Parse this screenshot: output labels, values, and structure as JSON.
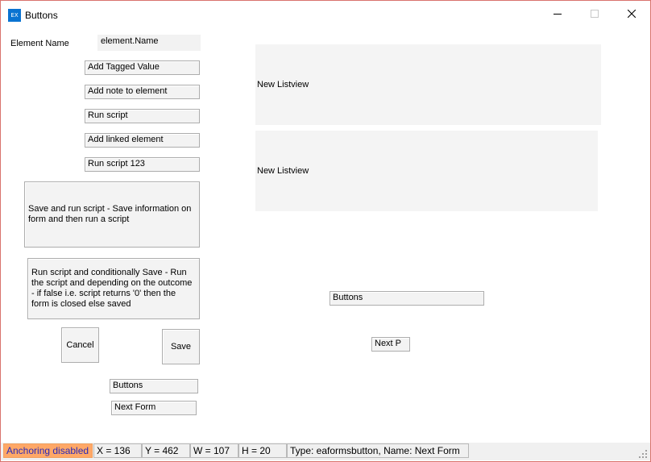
{
  "window": {
    "title": "Buttons",
    "icon_text": "EX"
  },
  "form": {
    "element_name_label": "Element Name",
    "element_name_value": "element.Name",
    "buttons": {
      "add_tagged_value": "Add Tagged Value",
      "add_note": "Add note to element",
      "run_script": "Run script",
      "add_linked_element": "Add linked element",
      "run_script_123": "Run script 123",
      "save_and_run": "Save and run script - Save information on form and then run a script",
      "run_cond_save": "Run script and conditionally Save - Run the script and depending on the outcome - if false i.e. script returns '0' then the form is closed else saved",
      "cancel": "Cancel",
      "save": "Save",
      "buttons_left": "Buttons",
      "next_form": "Next Form",
      "buttons_right": "Buttons",
      "next_p": "Next P"
    },
    "listviews": [
      "New Listview",
      "New Listview"
    ]
  },
  "statusbar": {
    "anchoring": "Anchoring disabled",
    "x": "X = 136",
    "y": "Y = 462",
    "w": "W = 107",
    "h": "H = 20",
    "type_info": "Type: eaformsbutton, Name: Next Form"
  },
  "colors": {
    "anchoring_bg": "#ffa867",
    "app_icon": "#0a73d1",
    "window_border": "#d9736d"
  }
}
